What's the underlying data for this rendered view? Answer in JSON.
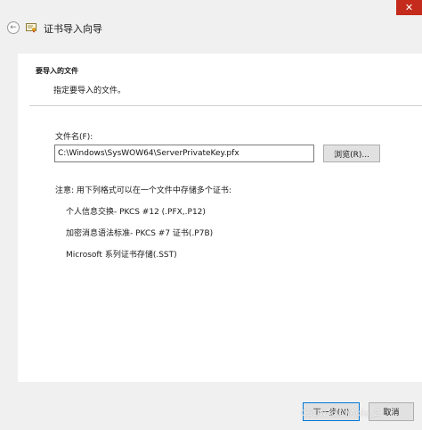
{
  "window": {
    "title": "证书导入向导",
    "close_glyph": "✕",
    "back_glyph": "←"
  },
  "header": {
    "title": "要导入的文件",
    "subtitle": "指定要导入的文件。"
  },
  "file": {
    "label": "文件名(F):",
    "value": "C:\\Windows\\SysWOW64\\ServerPrivateKey.pfx",
    "browse_label": "浏览(R)..."
  },
  "note": "注意: 用下列格式可以在一个文件中存储多个证书:",
  "formats": [
    "个人信息交换- PKCS #12 (.PFX,.P12)",
    "加密消息语法标准- PKCS #7 证书(.P7B)",
    "Microsoft 系列证书存储(.SST)"
  ],
  "buttons": {
    "next": "下一步(N)",
    "cancel": "取消"
  },
  "watermark": "CSDN @AnAqiu_Z",
  "colors": {
    "close": "#c42b1c",
    "accent": "#0078d7"
  }
}
